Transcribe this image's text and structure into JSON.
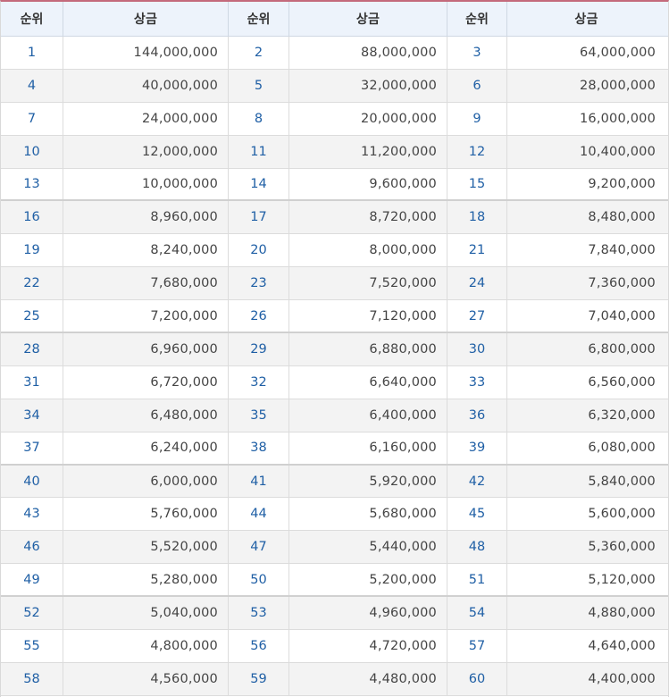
{
  "header": {
    "rank": "순위",
    "prize": "상금"
  },
  "rows": [
    [
      [
        "1",
        "144,000,000"
      ],
      [
        "2",
        "88,000,000"
      ],
      [
        "3",
        "64,000,000"
      ]
    ],
    [
      [
        "4",
        "40,000,000"
      ],
      [
        "5",
        "32,000,000"
      ],
      [
        "6",
        "28,000,000"
      ]
    ],
    [
      [
        "7",
        "24,000,000"
      ],
      [
        "8",
        "20,000,000"
      ],
      [
        "9",
        "16,000,000"
      ]
    ],
    [
      [
        "10",
        "12,000,000"
      ],
      [
        "11",
        "11,200,000"
      ],
      [
        "12",
        "10,400,000"
      ]
    ],
    [
      [
        "13",
        "10,000,000"
      ],
      [
        "14",
        "9,600,000"
      ],
      [
        "15",
        "9,200,000"
      ]
    ],
    [
      [
        "16",
        "8,960,000"
      ],
      [
        "17",
        "8,720,000"
      ],
      [
        "18",
        "8,480,000"
      ]
    ],
    [
      [
        "19",
        "8,240,000"
      ],
      [
        "20",
        "8,000,000"
      ],
      [
        "21",
        "7,840,000"
      ]
    ],
    [
      [
        "22",
        "7,680,000"
      ],
      [
        "23",
        "7,520,000"
      ],
      [
        "24",
        "7,360,000"
      ]
    ],
    [
      [
        "25",
        "7,200,000"
      ],
      [
        "26",
        "7,120,000"
      ],
      [
        "27",
        "7,040,000"
      ]
    ],
    [
      [
        "28",
        "6,960,000"
      ],
      [
        "29",
        "6,880,000"
      ],
      [
        "30",
        "6,800,000"
      ]
    ],
    [
      [
        "31",
        "6,720,000"
      ],
      [
        "32",
        "6,640,000"
      ],
      [
        "33",
        "6,560,000"
      ]
    ],
    [
      [
        "34",
        "6,480,000"
      ],
      [
        "35",
        "6,400,000"
      ],
      [
        "36",
        "6,320,000"
      ]
    ],
    [
      [
        "37",
        "6,240,000"
      ],
      [
        "38",
        "6,160,000"
      ],
      [
        "39",
        "6,080,000"
      ]
    ],
    [
      [
        "40",
        "6,000,000"
      ],
      [
        "41",
        "5,920,000"
      ],
      [
        "42",
        "5,840,000"
      ]
    ],
    [
      [
        "43",
        "5,760,000"
      ],
      [
        "44",
        "5,680,000"
      ],
      [
        "45",
        "5,600,000"
      ]
    ],
    [
      [
        "46",
        "5,520,000"
      ],
      [
        "47",
        "5,440,000"
      ],
      [
        "48",
        "5,360,000"
      ]
    ],
    [
      [
        "49",
        "5,280,000"
      ],
      [
        "50",
        "5,200,000"
      ],
      [
        "51",
        "5,120,000"
      ]
    ],
    [
      [
        "52",
        "5,040,000"
      ],
      [
        "53",
        "4,960,000"
      ],
      [
        "54",
        "4,880,000"
      ]
    ],
    [
      [
        "55",
        "4,800,000"
      ],
      [
        "56",
        "4,720,000"
      ],
      [
        "57",
        "4,640,000"
      ]
    ],
    [
      [
        "58",
        "4,560,000"
      ],
      [
        "59",
        "4,480,000"
      ],
      [
        "60",
        "4,400,000"
      ]
    ]
  ]
}
